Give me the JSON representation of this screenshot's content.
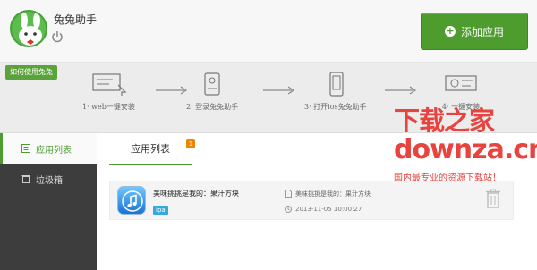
{
  "header": {
    "app_title": "兔兔助手",
    "add_app_label": "添加应用"
  },
  "tutorial": {
    "tag": "如何使用兔兔",
    "steps": [
      {
        "label": "1· web一键安装"
      },
      {
        "label": "2· 登录兔兔助手"
      },
      {
        "label": "3· 打开ios兔兔助手"
      },
      {
        "label": "4· 一键安装"
      }
    ]
  },
  "sidebar": {
    "items": [
      {
        "label": "应用列表",
        "active": true
      },
      {
        "label": "垃圾箱",
        "active": false
      }
    ]
  },
  "main": {
    "tab_label": "应用列表",
    "tab_badge": "1",
    "apps": [
      {
        "name": "美味挑挑是我的：果汁方块",
        "type": "ipa",
        "file_name": "美味挑挑是我的：果汁方块",
        "time": "2013-11-05 10:00:27"
      }
    ]
  },
  "watermark": {
    "title": "下载之家",
    "domain": "downza.cn",
    "slogan": "国内最专业的资源下载站！"
  },
  "colors": {
    "brand_green": "#4e9b2e",
    "sidebar_bg": "#3d3d3d",
    "badge_orange": "#f08300",
    "ipa_blue": "#34aadc",
    "watermark_red": "#e8433e"
  }
}
